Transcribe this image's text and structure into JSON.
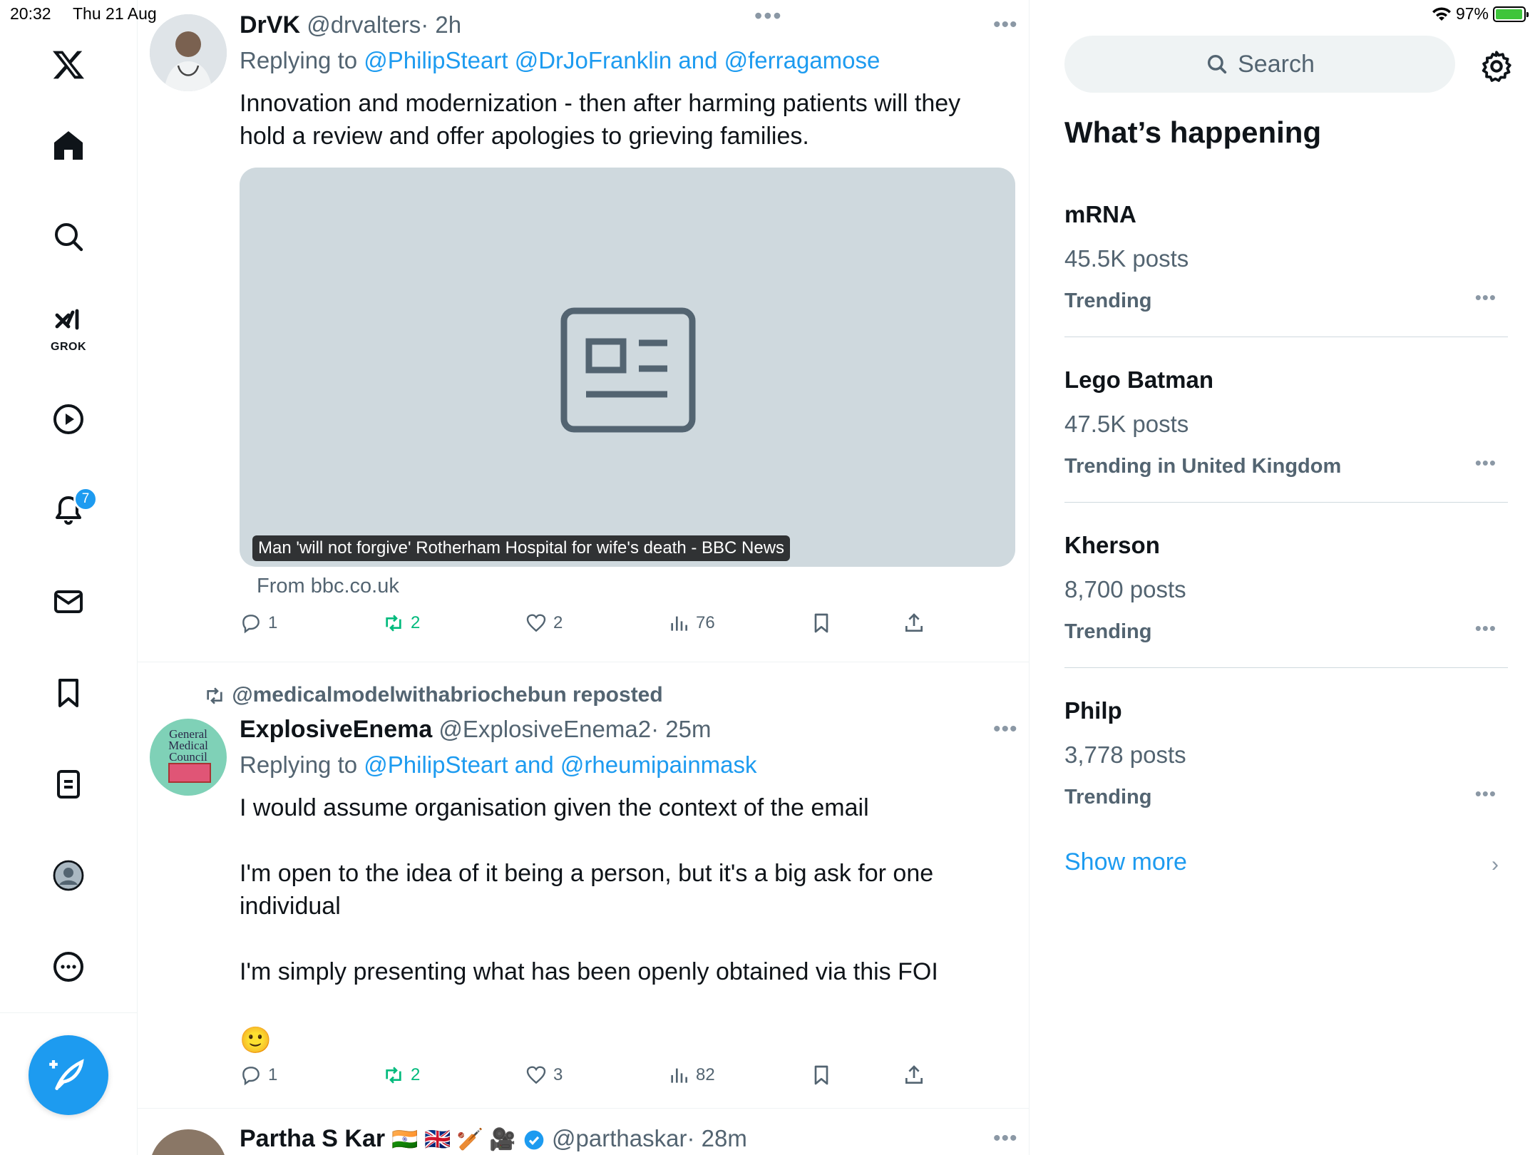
{
  "status_bar": {
    "time": "20:32",
    "date": "Thu 21 Aug",
    "battery": "97%",
    "battery_level": 0.97
  },
  "nav": {
    "grok_label": "GROK",
    "notifications_badge": "7"
  },
  "tweets": [
    {
      "name": "DrVK",
      "handle": "@drvalters",
      "time": "· 2h",
      "replying_prefix": "Replying to ",
      "replying_to": "@PhilipSteart @DrJoFranklin and @ferragamose",
      "text_lines": [
        "Innovation and modernization - then after harming patients will they",
        "hold a review and offer apologies to grieving families."
      ],
      "card_caption": "Man 'will not forgive' Rotherham Hospital for wife's death - BBC News",
      "card_source": "From bbc.co.uk",
      "replies": "1",
      "reposts": "2",
      "likes": "2",
      "views": "76"
    },
    {
      "repost_by": "@medicalmodelwithabriochebun reposted",
      "name": "ExplosiveEnema",
      "handle": "@ExplosiveEnema2",
      "time": "· 25m",
      "replying_prefix": "Replying to ",
      "replying_to": "@PhilipSteart and @rheumipainmask",
      "avatar_text": "General Medical Council",
      "text_lines": [
        "I would assume organisation given the context of the email",
        "I'm open to the idea of it being a person, but it's a big ask for one",
        "individual",
        "I'm simply presenting what has been openly obtained via this FOI"
      ],
      "emoji": "🙂",
      "replies": "1",
      "reposts": "2",
      "likes": "3",
      "views": "82"
    },
    {
      "name": "Partha S Kar",
      "flags": "🇮🇳 🇬🇧 🏏 🎥",
      "handle": "@parthaskar",
      "time": "· 28m"
    }
  ],
  "search": {
    "placeholder": "Search"
  },
  "whats_happening": "What’s happening",
  "trends": [
    {
      "name": "mRNA",
      "count": "45.5K posts",
      "context": "Trending"
    },
    {
      "name": "Lego Batman",
      "count": "47.5K posts",
      "context": "Trending in United Kingdom"
    },
    {
      "name": "Kherson",
      "count": "8,700 posts",
      "context": "Trending"
    },
    {
      "name": "Philp",
      "count": "3,778 posts",
      "context": "Trending"
    }
  ],
  "show_more": "Show more",
  "colors": {
    "accent": "#1d9bf0",
    "repost_green": "#00ba7c",
    "muted": "#536471"
  }
}
